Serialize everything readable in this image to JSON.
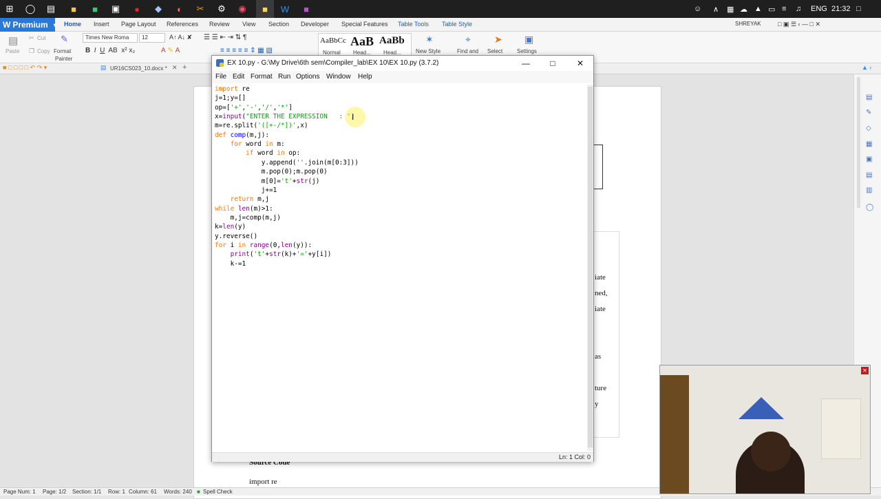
{
  "taskbar": {
    "lang": "ENG",
    "time": "21:32"
  },
  "wps": {
    "premium_label": "Premium",
    "tabs": [
      "Home",
      "Insert",
      "Page Layout",
      "References",
      "Review",
      "View",
      "Section",
      "Developer",
      "Special Features",
      "Table Tools",
      "Table Style"
    ],
    "user": "SHREYAK",
    "ribbon": {
      "paste": "Paste",
      "cut": "Cut",
      "copy": "Copy",
      "format_painter_1": "Format",
      "format_painter_2": "Painter",
      "font": "Times New Roma",
      "size": "12",
      "style_normal": "Normal",
      "style_heading1": "Head...",
      "style_heading2": "Head...",
      "style_prev_1": "AaBbCc",
      "style_prev_2": "AaB",
      "style_prev_3": "AaBb",
      "new_style": "New Style",
      "find_replace": "Find and",
      "select": "Select",
      "settings": "Settings"
    },
    "doc_tab": "UR16CS023_10.docx *",
    "doc_fragments": [
      "iate",
      "ned,",
      "iate",
      "as",
      "ture",
      "y"
    ],
    "source_heading": "Source Code",
    "source_line": "import re",
    "status": {
      "page_num": "Page Num: 1",
      "page": "Page: 1/2",
      "section": "Section: 1/1",
      "row": "Row: 1",
      "column": "Column: 61",
      "words": "Words: 240",
      "spell": "Spell Check"
    }
  },
  "idle": {
    "title": "EX 10.py - G:\\My Drive\\6th sem\\Compiler_lab\\EX 10\\EX 10.py (3.7.2)",
    "menu": [
      "File",
      "Edit",
      "Format",
      "Run",
      "Options",
      "Window",
      "Help"
    ],
    "code": [
      [
        {
          "t": "import",
          "c": "kw"
        },
        {
          "t": " re",
          "c": ""
        }
      ],
      [
        {
          "t": "j=1;y=[]",
          "c": ""
        }
      ],
      [
        {
          "t": "op=[",
          "c": ""
        },
        {
          "t": "'+'",
          "c": "str"
        },
        {
          "t": ",",
          "c": ""
        },
        {
          "t": "'-'",
          "c": "str"
        },
        {
          "t": ",",
          "c": ""
        },
        {
          "t": "'/'",
          "c": "str"
        },
        {
          "t": ",",
          "c": ""
        },
        {
          "t": "'*'",
          "c": "str"
        },
        {
          "t": "]",
          "c": ""
        }
      ],
      [
        {
          "t": "x=",
          "c": ""
        },
        {
          "t": "input",
          "c": "bi"
        },
        {
          "t": "(",
          "c": ""
        },
        {
          "t": "\"ENTER THE EXPRESSION   : \"",
          "c": "str"
        },
        {
          "t": ")",
          "c": ""
        }
      ],
      [
        {
          "t": "m=re.split(",
          "c": ""
        },
        {
          "t": "'([+-/*])'",
          "c": "str"
        },
        {
          "t": ",x)",
          "c": ""
        }
      ],
      [
        {
          "t": "def",
          "c": "kw"
        },
        {
          "t": " ",
          "c": ""
        },
        {
          "t": "comp",
          "c": "def"
        },
        {
          "t": "(m,j):",
          "c": ""
        }
      ],
      [
        {
          "t": "    ",
          "c": ""
        },
        {
          "t": "for",
          "c": "kw"
        },
        {
          "t": " word ",
          "c": ""
        },
        {
          "t": "in",
          "c": "kw"
        },
        {
          "t": " m:",
          "c": ""
        }
      ],
      [
        {
          "t": "        ",
          "c": ""
        },
        {
          "t": "if",
          "c": "kw"
        },
        {
          "t": " word ",
          "c": ""
        },
        {
          "t": "in",
          "c": "kw"
        },
        {
          "t": " op:",
          "c": ""
        }
      ],
      [
        {
          "t": "            y.append(",
          "c": ""
        },
        {
          "t": "''",
          "c": "str"
        },
        {
          "t": ".join(m[0:3]))",
          "c": ""
        }
      ],
      [
        {
          "t": "            m.pop(0);m.pop(0)",
          "c": ""
        }
      ],
      [
        {
          "t": "            m[0]=",
          "c": ""
        },
        {
          "t": "'t'",
          "c": "str"
        },
        {
          "t": "+",
          "c": ""
        },
        {
          "t": "str",
          "c": "bi"
        },
        {
          "t": "(j)",
          "c": ""
        }
      ],
      [
        {
          "t": "            j+=1",
          "c": ""
        }
      ],
      [
        {
          "t": "    ",
          "c": ""
        },
        {
          "t": "return",
          "c": "kw"
        },
        {
          "t": " m,j",
          "c": ""
        }
      ],
      [
        {
          "t": "while",
          "c": "kw"
        },
        {
          "t": " ",
          "c": ""
        },
        {
          "t": "len",
          "c": "bi"
        },
        {
          "t": "(m)>1:",
          "c": ""
        }
      ],
      [
        {
          "t": "    m,j=comp(m,j)",
          "c": ""
        }
      ],
      [
        {
          "t": "k=",
          "c": ""
        },
        {
          "t": "len",
          "c": "bi"
        },
        {
          "t": "(y)",
          "c": ""
        }
      ],
      [
        {
          "t": "y.reverse()",
          "c": ""
        }
      ],
      [
        {
          "t": "for",
          "c": "kw"
        },
        {
          "t": " i ",
          "c": ""
        },
        {
          "t": "in",
          "c": "kw"
        },
        {
          "t": " ",
          "c": ""
        },
        {
          "t": "range",
          "c": "bi"
        },
        {
          "t": "(0,",
          "c": ""
        },
        {
          "t": "len",
          "c": "bi"
        },
        {
          "t": "(y)):",
          "c": ""
        }
      ],
      [
        {
          "t": "    ",
          "c": ""
        },
        {
          "t": "print",
          "c": "bi"
        },
        {
          "t": "(",
          "c": ""
        },
        {
          "t": "'t'",
          "c": "str"
        },
        {
          "t": "+",
          "c": ""
        },
        {
          "t": "str",
          "c": "bi"
        },
        {
          "t": "(k)+",
          "c": ""
        },
        {
          "t": "'='",
          "c": "str"
        },
        {
          "t": "+y[i])",
          "c": ""
        }
      ],
      [
        {
          "t": "    k-=1",
          "c": ""
        }
      ]
    ],
    "status": "Ln: 1  Col: 0"
  },
  "colors": {
    "keyword": "#ff7700",
    "builtin": "#900090",
    "string": "#00aa00",
    "defname": "#0000ff",
    "wps_accent": "#2b79d6"
  }
}
